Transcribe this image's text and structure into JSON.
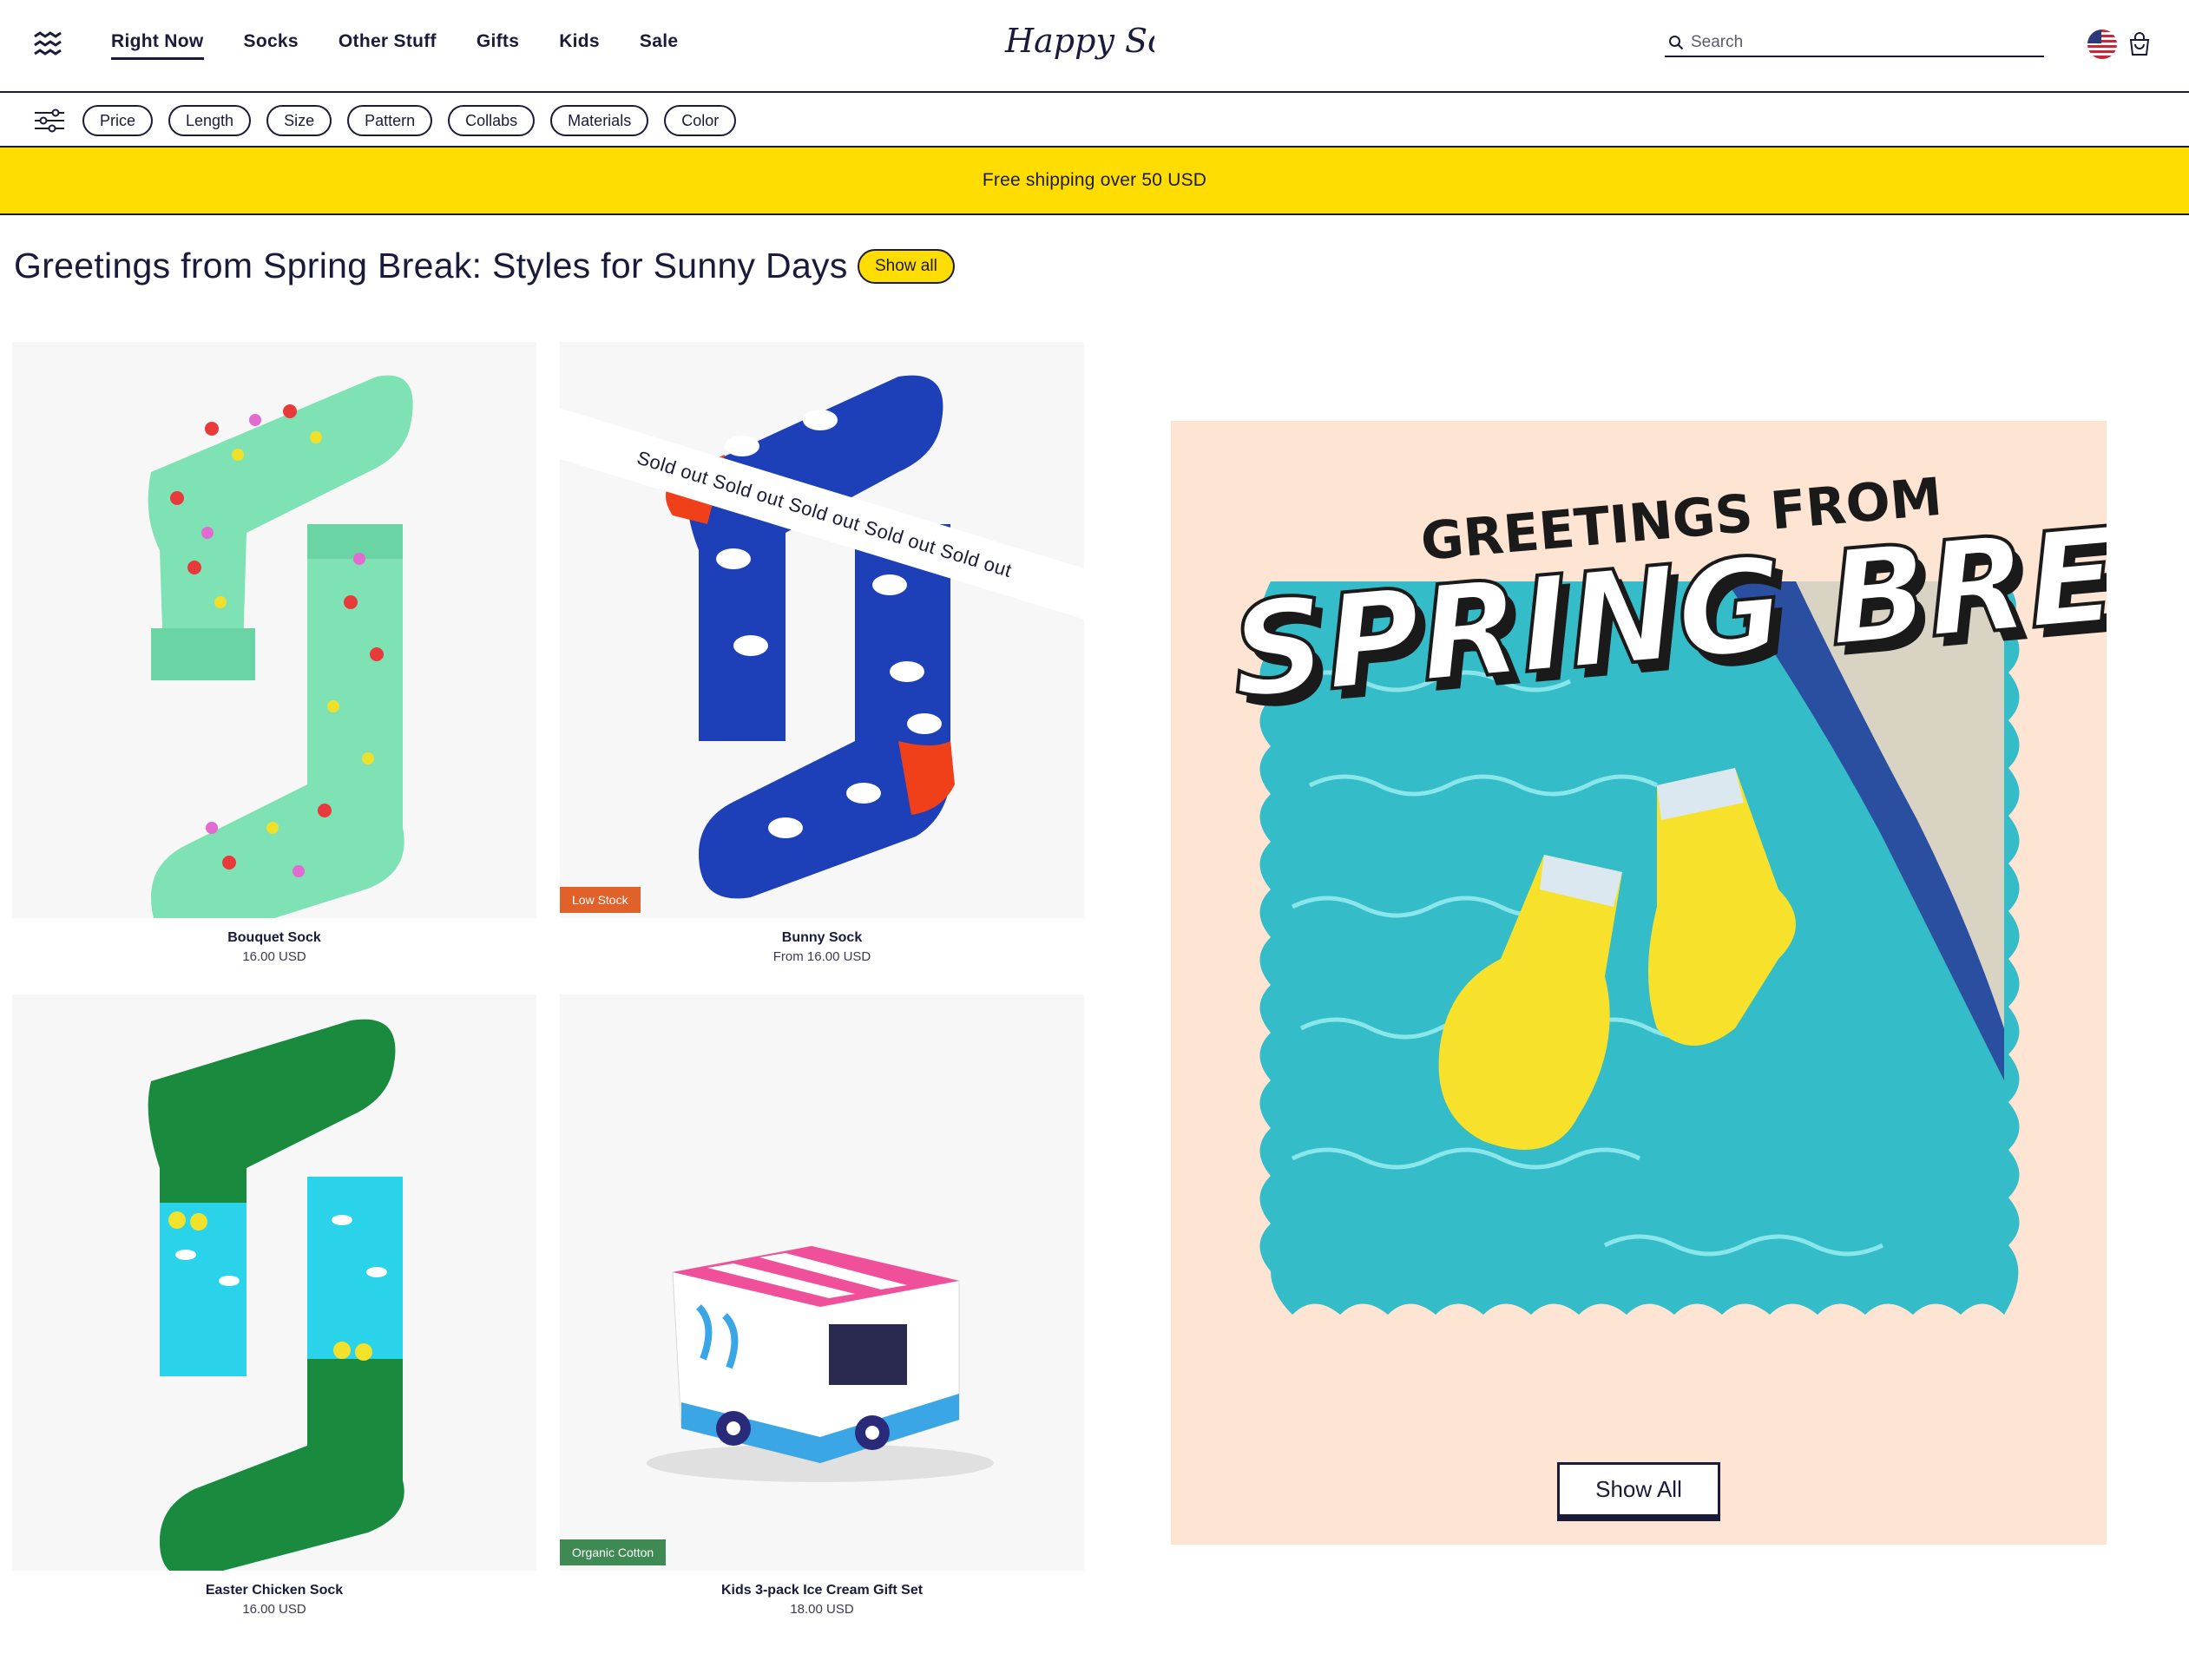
{
  "header": {
    "nav": [
      "Right Now",
      "Socks",
      "Other Stuff",
      "Gifts",
      "Kids",
      "Sale"
    ],
    "active_nav": "Right Now",
    "logo_text": "Happy Socks",
    "search_placeholder": "Search",
    "icons": {
      "menu": "wave-menu-icon",
      "search": "search-icon",
      "flag": "us-flag-icon",
      "cart": "shopping-bag-icon"
    }
  },
  "filters": {
    "icon": "sliders-icon",
    "chips": [
      "Price",
      "Length",
      "Size",
      "Pattern",
      "Collabs",
      "Materials",
      "Color"
    ]
  },
  "promo": {
    "text": "Free shipping over 50 USD",
    "color": "#ffdd00"
  },
  "section": {
    "title": "Greetings from Spring Break: Styles for Sunny Days",
    "show_all": "Show all"
  },
  "products": [
    {
      "name": "Bouquet Sock",
      "price": "16.00 USD",
      "badge": "",
      "sold_out": ""
    },
    {
      "name": "Bunny Sock",
      "price": "From 16.00 USD",
      "badge": "Low Stock",
      "sold_out": "Sold out Sold out Sold out Sold out Sold out"
    },
    {
      "name": "Easter Chicken Sock",
      "price": "16.00 USD",
      "badge": "",
      "sold_out": ""
    },
    {
      "name": "Kids 3-pack Ice Cream Gift Set",
      "price": "18.00 USD",
      "badge": "Organic Cotton",
      "sold_out": ""
    }
  ],
  "banner": {
    "line1": "GREETINGS FROM",
    "line2": "SPRING BREAK",
    "button": "Show All",
    "background": "#fde4d3"
  },
  "colors": {
    "ink": "#1a1a3a",
    "accent_yellow": "#ffdd00",
    "low_stock": "#e0622a",
    "organic": "#3f8a52"
  }
}
